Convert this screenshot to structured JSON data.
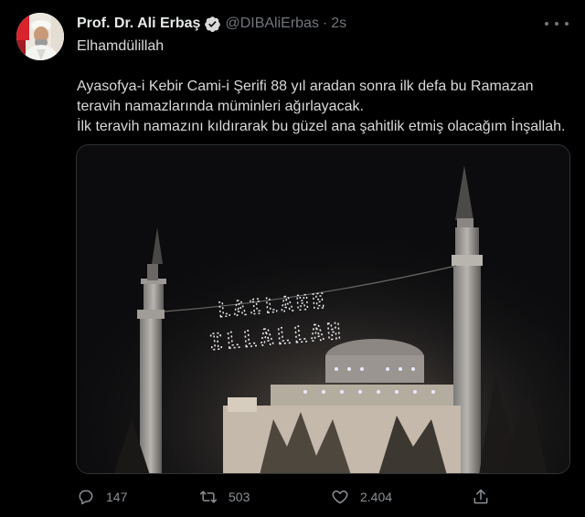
{
  "tweet": {
    "author_name": "Prof. Dr. Ali Erbaş",
    "handle": "@DIBAliErbas",
    "separator": "·",
    "time": "2s",
    "lines": [
      "Elhamdülillah",
      "",
      "Ayasofya-i Kebir Cami-i Şerifi 88 yıl aradan sonra ilk defa bu Ramazan",
      "teravih namazlarında müminleri ağırlayacak.",
      "İlk teravih namazını kıldırarak bu güzel ana şahitlik etmiş olacağım İnşallah."
    ]
  },
  "media": {
    "mahya_line1": "LAILAHE",
    "mahya_line2": "ILLALLAH",
    "colors": {
      "sky": "#0c0c0e",
      "lights": "#f2f0f6"
    }
  },
  "actions": {
    "reply_count": "147",
    "retweet_count": "503",
    "like_count": "2.404"
  },
  "icons": {
    "verified": "verified-badge-icon",
    "more": "more-dots-icon",
    "reply": "reply-icon",
    "retweet": "retweet-icon",
    "like": "heart-icon",
    "share": "share-icon"
  },
  "colors": {
    "background": "#000000",
    "text": "#d9d9d9",
    "muted": "#71767b",
    "verified": "#1d9bf0"
  }
}
